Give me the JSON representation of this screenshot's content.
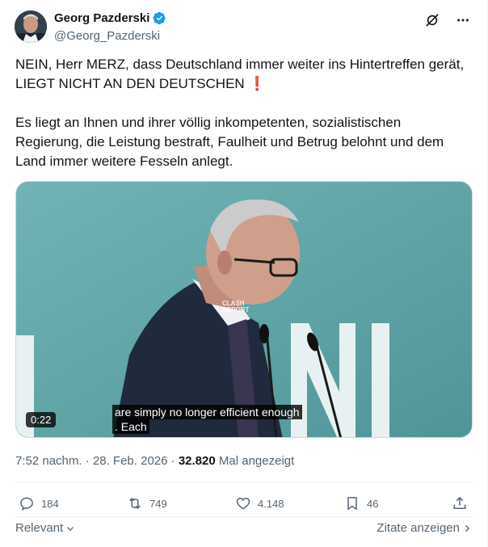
{
  "author": {
    "display_name": "Georg Pazderski",
    "handle": "@Georg_Pazderski",
    "verified": true
  },
  "header_icons": [
    "grok-icon",
    "more-icon"
  ],
  "text": {
    "paragraph1": "NEIN, Herr MERZ, dass Deutschland immer weiter ins Hintertreffen gerät, LIEGT NICHT AN DEN DEUTSCHEN",
    "paragraph1_emoji": "❗",
    "paragraph2": "Es liegt an Ihnen und ihrer völlig inkompetenten, sozialistischen Regierung, die Leistung bestraft, Faulheit und Betrug belohnt und dem Land immer weitere Fesseln anlegt."
  },
  "media": {
    "duration": "0:22",
    "caption_line1": "are simply no longer efficient enough",
    "caption_line2": ".  Each",
    "watermark_line1": "CLASH",
    "watermark_line2": "REPORT"
  },
  "meta": {
    "time": "7:52 nachm.",
    "separator": "·",
    "date": "28. Feb. 2026",
    "views": "32.820",
    "views_label": "Mal angezeigt"
  },
  "actions": {
    "replies": "184",
    "reposts": "749",
    "likes": "4.148",
    "bookmarks": "46"
  },
  "footer": {
    "sort_label": "Relevant",
    "quotes_label": "Zitate anzeigen"
  },
  "colors": {
    "text": "#0f1419",
    "secondary": "#536471",
    "verified": "#1d9bf0",
    "emoji_red": "#d0021b"
  }
}
